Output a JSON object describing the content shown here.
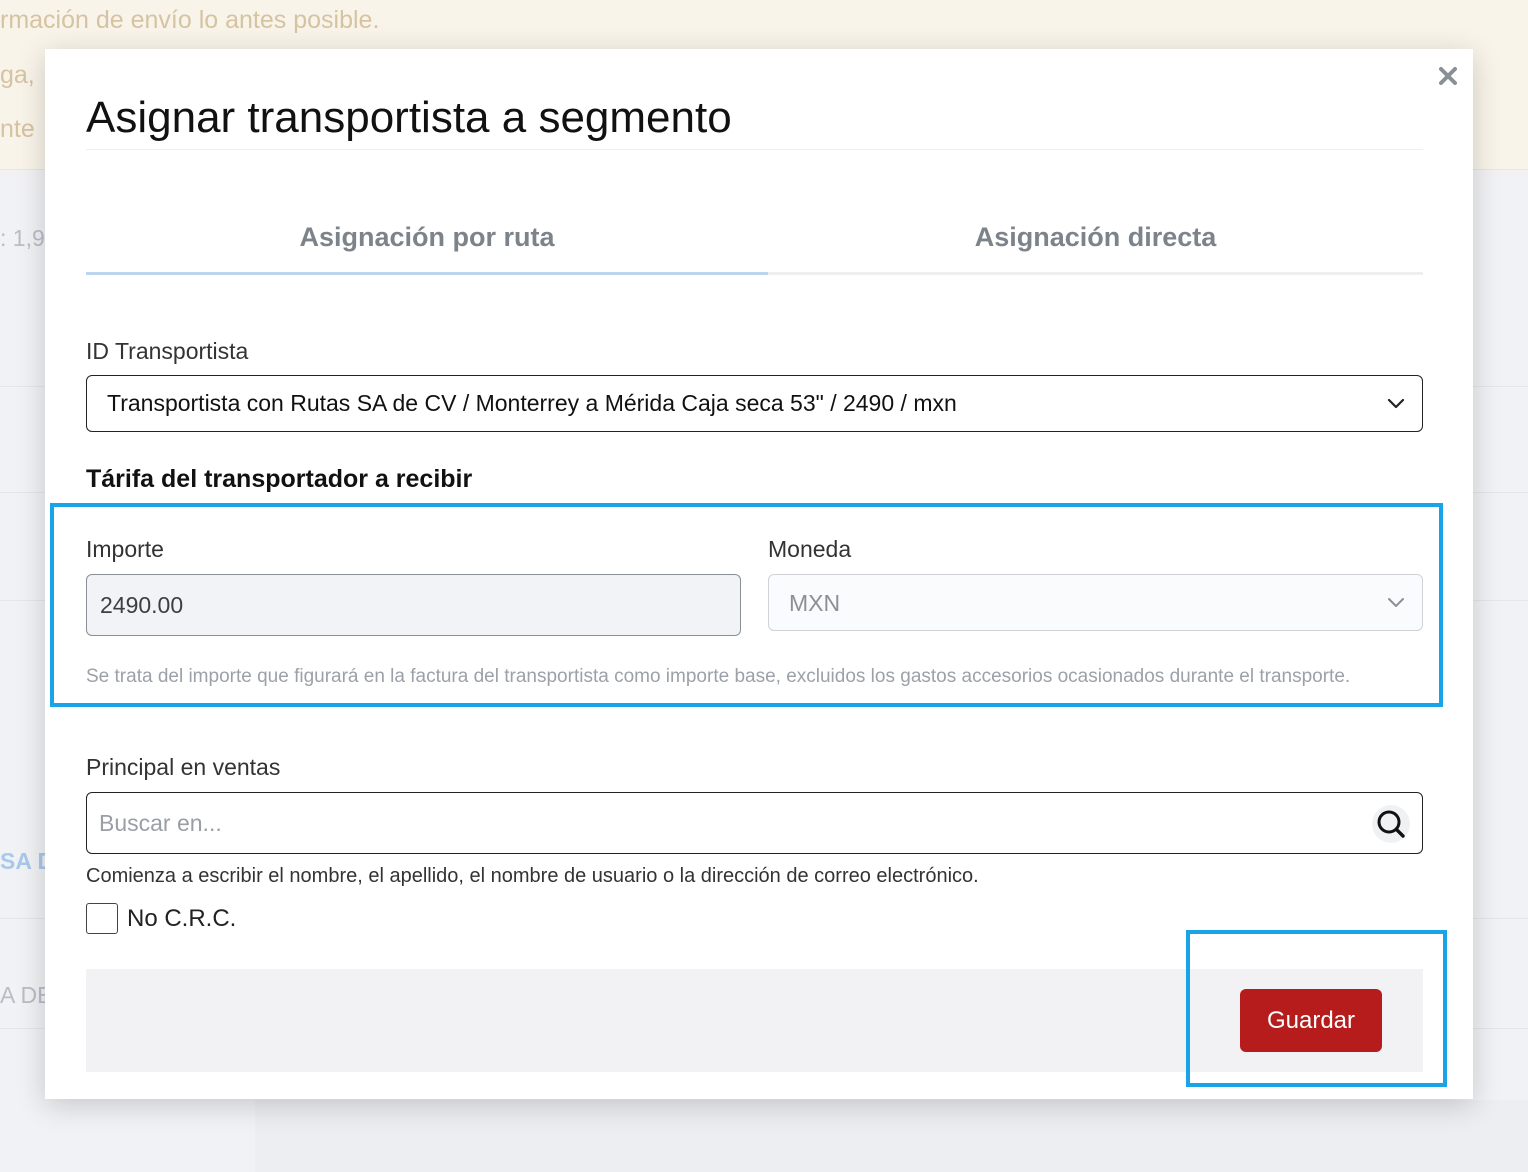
{
  "background": {
    "banner_lines": [
      "rmación de envío lo antes posible.",
      "ga,",
      "nte"
    ],
    "side_texts": [
      ": 1,9",
      "SA D",
      "A DE"
    ]
  },
  "modal": {
    "title": "Asignar transportista a segmento",
    "close_icon": "close-icon",
    "tabs": [
      {
        "label": "Asignación por ruta",
        "active": true
      },
      {
        "label": "Asignación directa",
        "active": false
      }
    ],
    "carrier": {
      "label": "ID Transportista",
      "value": "Transportista con Rutas SA de CV / Monterrey a Mérida Caja seca 53\" / 2490 / mxn"
    },
    "rate_section": {
      "title": "Tárifa del transportador a recibir",
      "amount_label": "Importe",
      "amount_value": "2490.00",
      "currency_label": "Moneda",
      "currency_value": "MXN",
      "help": "Se trata del importe que figurará en la factura del transportista como importe base, excluidos los gastos accesorios ocasionados durante el transporte."
    },
    "sales_lead": {
      "label": "Principal en ventas",
      "placeholder": "Buscar en...",
      "hint": "Comienza a escribir el nombre, el apellido, el nombre de usuario o la dirección de correo electrónico.",
      "search_icon": "search-icon"
    },
    "no_crc": {
      "label": "No C.R.C.",
      "checked": false
    },
    "save_label": "Guardar"
  },
  "colors": {
    "accent": "#1aa3e8",
    "save_button": "#b71c1c",
    "active_tab_underline": "#bcd4ee"
  }
}
